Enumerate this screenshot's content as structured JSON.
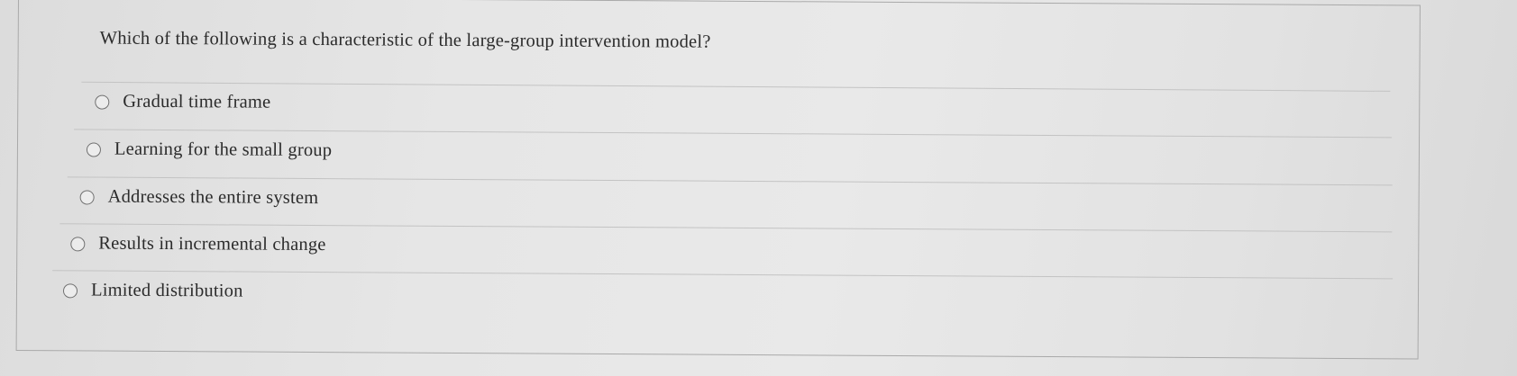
{
  "question": {
    "prompt": "Which of the following is a characteristic of the large-group intervention model?"
  },
  "answers": [
    {
      "label": "Gradual time frame",
      "selected": false
    },
    {
      "label": "Learning for the small group",
      "selected": false
    },
    {
      "label": "Addresses the entire system",
      "selected": false
    },
    {
      "label": "Results in incremental change",
      "selected": false
    },
    {
      "label": "Limited distribution",
      "selected": false
    }
  ]
}
